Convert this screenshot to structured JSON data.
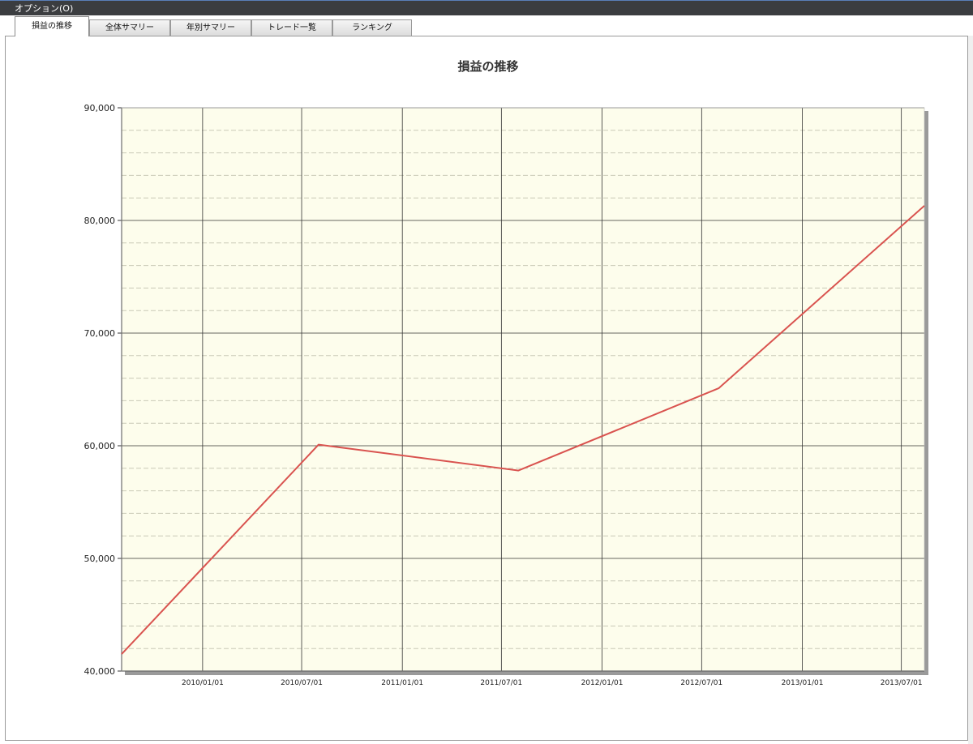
{
  "menubar": {
    "options_label": "オプション(O)"
  },
  "tabs": [
    {
      "label": "損益の推移",
      "active": true
    },
    {
      "label": "全体サマリー",
      "active": false
    },
    {
      "label": "年別サマリー",
      "active": false
    },
    {
      "label": "トレード一覧",
      "active": false
    },
    {
      "label": "ランキング",
      "active": false
    }
  ],
  "colors": {
    "plot_background": "#fdfdec",
    "series_line": "#d9534f",
    "major_grid": "#333333",
    "minor_grid": "#c9c9b6"
  },
  "chart_data": {
    "type": "line",
    "title": "損益の推移",
    "xlabel": "",
    "ylabel": "",
    "ylim": [
      40000,
      90000
    ],
    "xlim": [
      "2009-08-06",
      "2013-08-12"
    ],
    "y_ticks": [
      "40,000",
      "50,000",
      "60,000",
      "70,000",
      "80,000",
      "90,000"
    ],
    "x_tick_labels": [
      "2010/01/01",
      "2010/07/01",
      "2011/01/01",
      "2011/07/01",
      "2012/01/01",
      "2012/07/01",
      "2013/01/01",
      "2013/07/01"
    ],
    "grid": true,
    "legend": "none",
    "series": [
      {
        "x": [
          "2009-08-06",
          "2010-08-01",
          "2011-08-01",
          "2012-08-01",
          "2013-08-12"
        ],
        "y": [
          41500,
          60100,
          57800,
          65100,
          81300
        ]
      }
    ]
  }
}
